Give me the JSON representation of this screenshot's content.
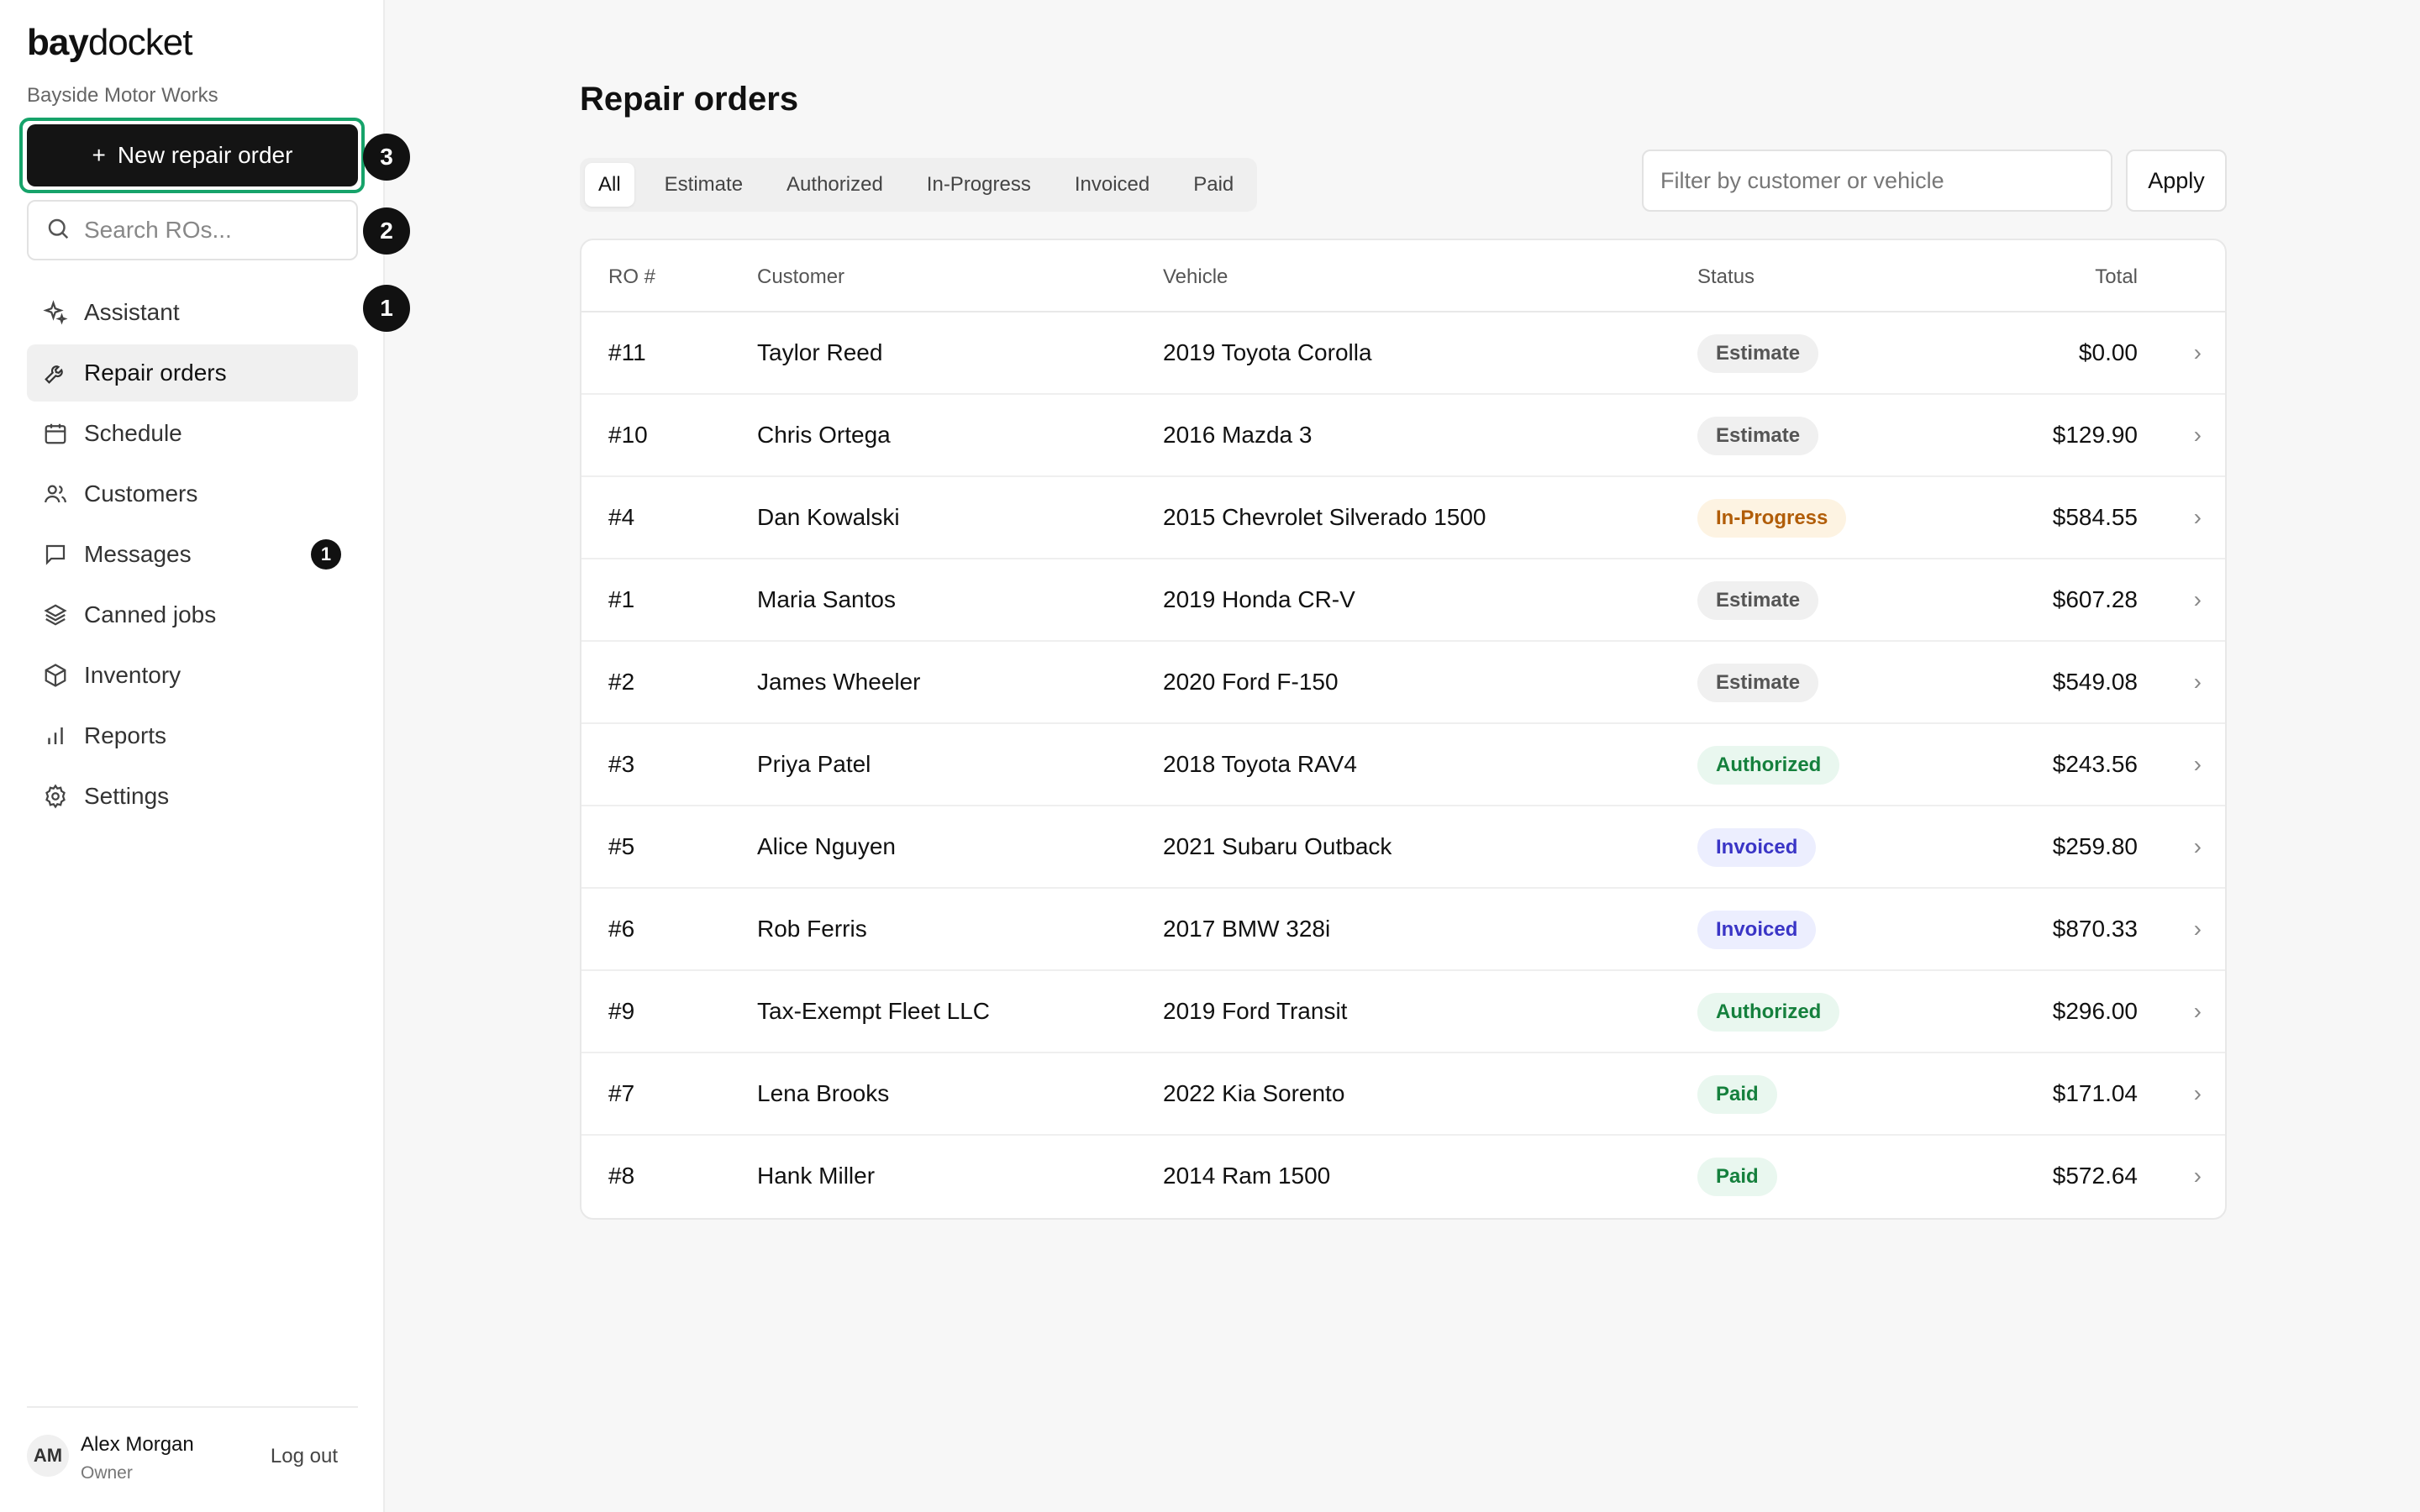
{
  "brand": {
    "bold": "bay",
    "light": "docket",
    "shop_name": "Bayside Motor Works"
  },
  "sidebar": {
    "new_button_label": "New repair order",
    "search_placeholder": "Search ROs...",
    "marker_labels": [
      "3",
      "2",
      "1"
    ],
    "items": [
      {
        "label": "Assistant",
        "icon": "sparkle-icon"
      },
      {
        "label": "Repair orders",
        "icon": "wrench-icon",
        "active": true
      },
      {
        "label": "Schedule",
        "icon": "calendar-icon"
      },
      {
        "label": "Customers",
        "icon": "users-icon"
      },
      {
        "label": "Messages",
        "icon": "message-icon",
        "count": "1"
      },
      {
        "label": "Canned jobs",
        "icon": "layers-icon"
      },
      {
        "label": "Inventory",
        "icon": "box-icon"
      },
      {
        "label": "Reports",
        "icon": "bar-chart-icon"
      },
      {
        "label": "Settings",
        "icon": "gear-icon"
      }
    ],
    "user": {
      "initials": "AM",
      "name": "Alex Morgan",
      "role": "Owner",
      "logout_label": "Log out"
    }
  },
  "main": {
    "title": "Repair orders",
    "tabs": [
      "All",
      "Estimate",
      "Authorized",
      "In-Progress",
      "Invoiced",
      "Paid"
    ],
    "active_tab": "All",
    "filter_placeholder": "Filter by customer or vehicle",
    "apply_label": "Apply",
    "columns": {
      "ro": "RO #",
      "customer": "Customer",
      "vehicle": "Vehicle",
      "status": "Status",
      "total": "Total"
    },
    "rows": [
      {
        "ro": "#11",
        "customer": "Taylor Reed",
        "vehicle": "2019 Toyota Corolla",
        "status": "Estimate",
        "total": "$0.00"
      },
      {
        "ro": "#10",
        "customer": "Chris Ortega",
        "vehicle": "2016 Mazda 3",
        "status": "Estimate",
        "total": "$129.90"
      },
      {
        "ro": "#4",
        "customer": "Dan Kowalski",
        "vehicle": "2015 Chevrolet Silverado 1500",
        "status": "In-Progress",
        "total": "$584.55"
      },
      {
        "ro": "#1",
        "customer": "Maria Santos",
        "vehicle": "2019 Honda CR-V",
        "status": "Estimate",
        "total": "$607.28"
      },
      {
        "ro": "#2",
        "customer": "James Wheeler",
        "vehicle": "2020 Ford F-150",
        "status": "Estimate",
        "total": "$549.08"
      },
      {
        "ro": "#3",
        "customer": "Priya Patel",
        "vehicle": "2018 Toyota RAV4",
        "status": "Authorized",
        "total": "$243.56"
      },
      {
        "ro": "#5",
        "customer": "Alice Nguyen",
        "vehicle": "2021 Subaru Outback",
        "status": "Invoiced",
        "total": "$259.80"
      },
      {
        "ro": "#6",
        "customer": "Rob Ferris",
        "vehicle": "2017 BMW 328i",
        "status": "Invoiced",
        "total": "$870.33"
      },
      {
        "ro": "#9",
        "customer": "Tax-Exempt Fleet LLC",
        "vehicle": "2019 Ford Transit",
        "status": "Authorized",
        "total": "$296.00"
      },
      {
        "ro": "#7",
        "customer": "Lena Brooks",
        "vehicle": "2022 Kia Sorento",
        "status": "Paid",
        "total": "$171.04"
      },
      {
        "ro": "#8",
        "customer": "Hank Miller",
        "vehicle": "2014 Ram 1500",
        "status": "Paid",
        "total": "$572.64"
      }
    ],
    "row_chevron": "›"
  },
  "colors": {
    "accent_ring": "#16a36a",
    "primary_button": "#141414"
  }
}
